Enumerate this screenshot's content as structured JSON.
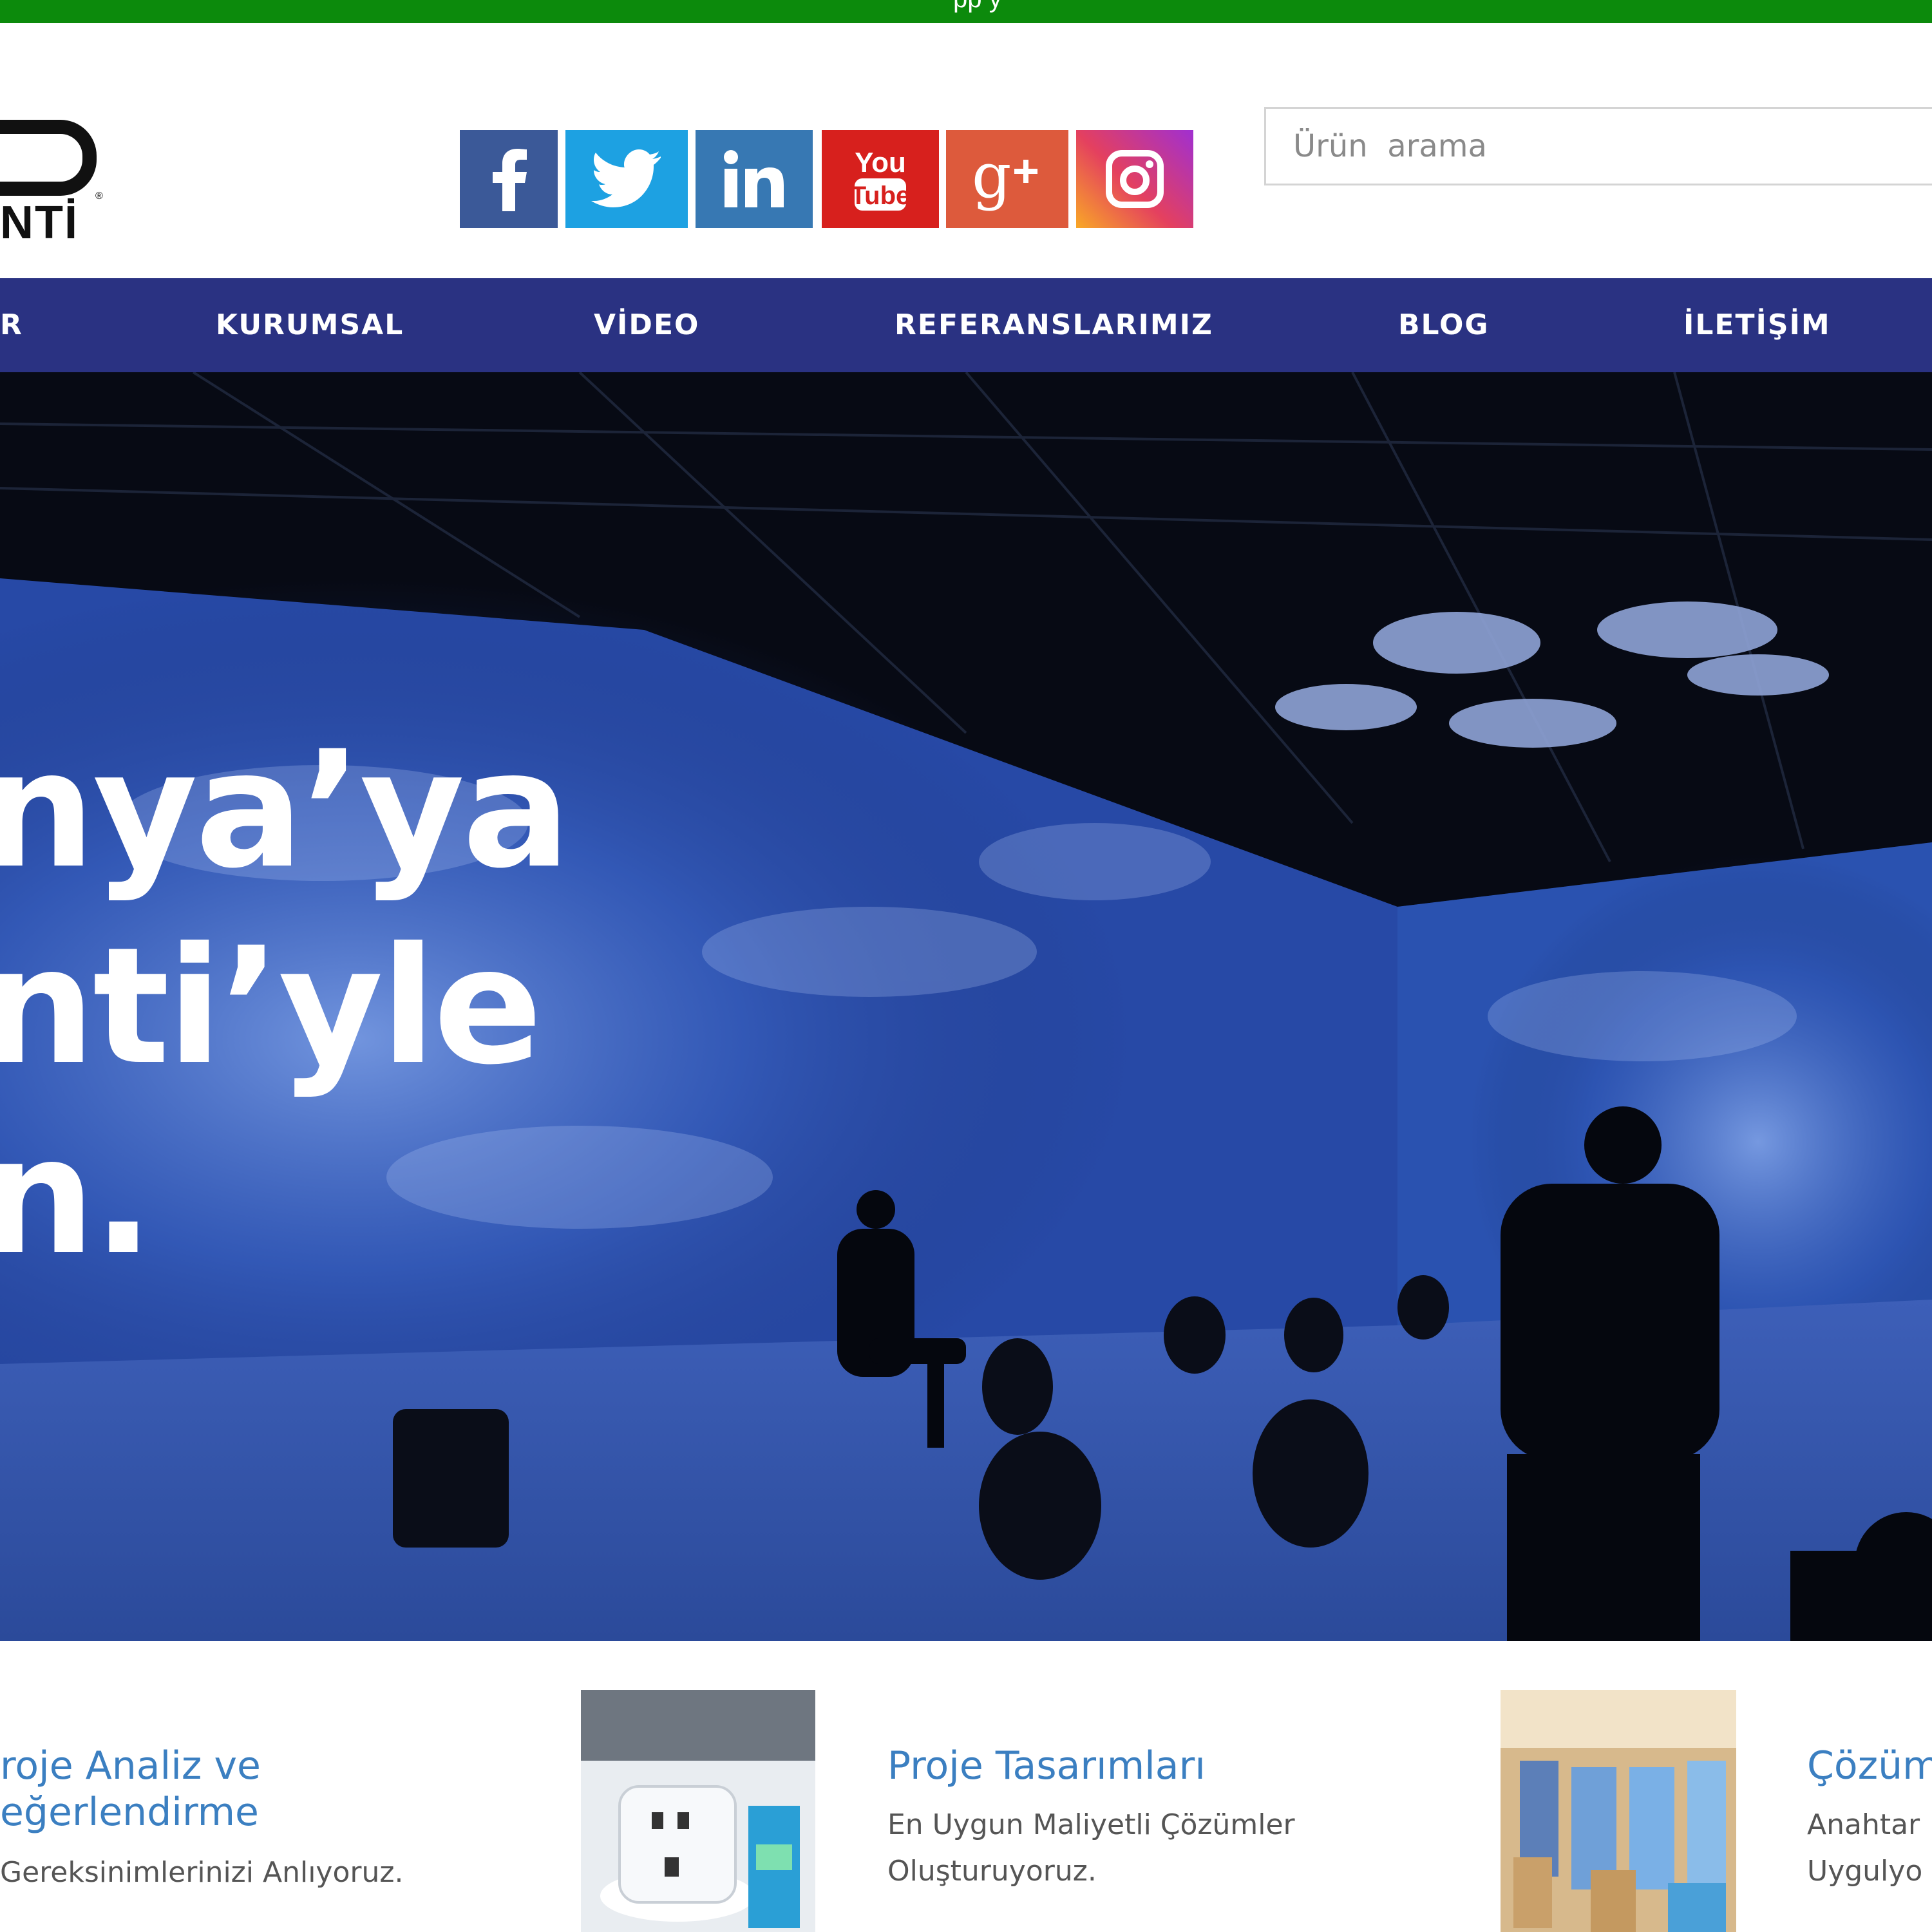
{
  "topbar": {
    "text": "pp  y"
  },
  "logo": {
    "text": "NTİ"
  },
  "social": [
    {
      "name": "facebook-icon",
      "color": "#3b5998"
    },
    {
      "name": "twitter-icon",
      "color": "#1da1e2"
    },
    {
      "name": "linkedin-icon",
      "color": "#3778b3"
    },
    {
      "name": "youtube-icon",
      "color": "#d7201d"
    },
    {
      "name": "google-plus-icon",
      "color": "#dd5a3c"
    },
    {
      "name": "instagram-icon",
      "color": "#c13584"
    }
  ],
  "search": {
    "placeholder": "Ürün  arama"
  },
  "nav": {
    "items": [
      "R",
      "KURUMSAL",
      "VİDEO",
      "REFERANSLARIMIZ",
      "BLOG",
      "İLETİŞİM"
    ]
  },
  "hero": {
    "lines": [
      "nya’ya",
      "nti’yle",
      "n."
    ]
  },
  "features": [
    {
      "title_1": "roje Analiz ve",
      "title_2": "eğerlendirme",
      "desc_1": "Gereksinimlerinizi Anlıyoruz."
    },
    {
      "title_1": "Proje Tasarımları",
      "desc_1": "En Uygun Maliyetli Çözümler",
      "desc_2": "Oluşturuyoruz."
    },
    {
      "title_1": "Çözüm",
      "desc_1": "Anahtar",
      "desc_2": "Uygulyo"
    }
  ],
  "colors": {
    "topbar": "#0c8a0c",
    "nav": "#2a3282",
    "feature_title": "#3b7fc1"
  }
}
